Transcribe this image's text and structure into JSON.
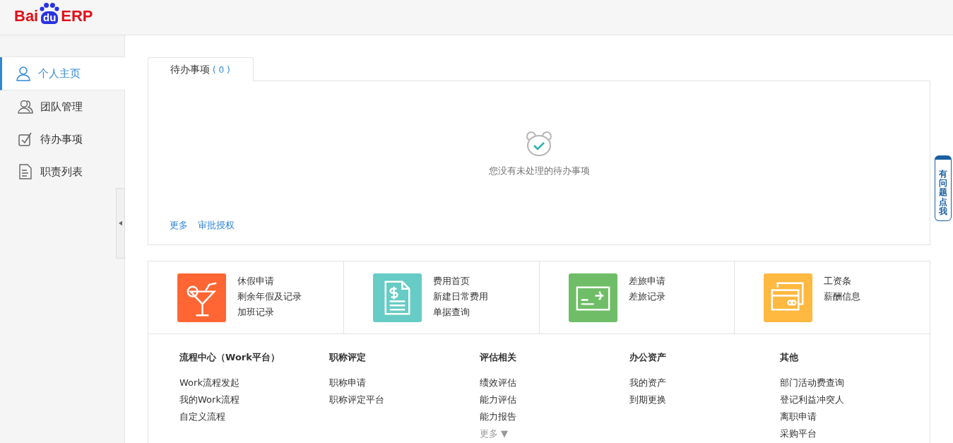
{
  "logo": {
    "prefix": "Bai",
    "badge": "du",
    "suffix": "ERP"
  },
  "sidebar": {
    "items": [
      {
        "label": "个人主页",
        "kind": "person",
        "selected": true
      },
      {
        "label": "团队管理",
        "kind": "team",
        "selected": false
      },
      {
        "label": "待办事项",
        "kind": "check",
        "selected": false
      },
      {
        "label": "职责列表",
        "kind": "document",
        "selected": false
      }
    ]
  },
  "todo": {
    "tab": {
      "label": "待办事项",
      "count": "( 0 )",
      "selected": true
    },
    "empty_message": "您没有未处理的待办事项",
    "links": [
      "更多",
      "审批授权"
    ]
  },
  "quick_apps": [
    {
      "kind": "cocktail",
      "color": "#ff6633",
      "links": [
        "休假申请",
        "剩余年假及记录",
        "加班记录"
      ]
    },
    {
      "kind": "invoice",
      "color": "#66ccc5",
      "links": [
        "费用首页",
        "新建日常费用",
        "单据查询"
      ]
    },
    {
      "kind": "ticket",
      "color": "#6fbd66",
      "links": [
        "差旅申请",
        "差旅记录"
      ]
    },
    {
      "kind": "cards",
      "color": "#ffb940",
      "links": [
        "工资条",
        "薪酬信息"
      ]
    }
  ],
  "link_groups": [
    {
      "title": "流程中心（Work平台）",
      "links": [
        "Work流程发起",
        "我的Work流程",
        "自定义流程"
      ]
    },
    {
      "title": "职称评定",
      "links": [
        "职称申请",
        "职称评定平台"
      ]
    },
    {
      "title": "评估相关",
      "links": [
        "绩效评估",
        "能力评估",
        "能力报告"
      ],
      "more": "更多 ▼"
    },
    {
      "title": "办公资产",
      "links": [
        "我的资产",
        "到期更换"
      ]
    },
    {
      "title": "其他",
      "links": [
        "部门活动费查询",
        "登记利益冲突人",
        "离职申请",
        "采购平台"
      ]
    }
  ],
  "help_button": {
    "label": "有问题点我"
  }
}
